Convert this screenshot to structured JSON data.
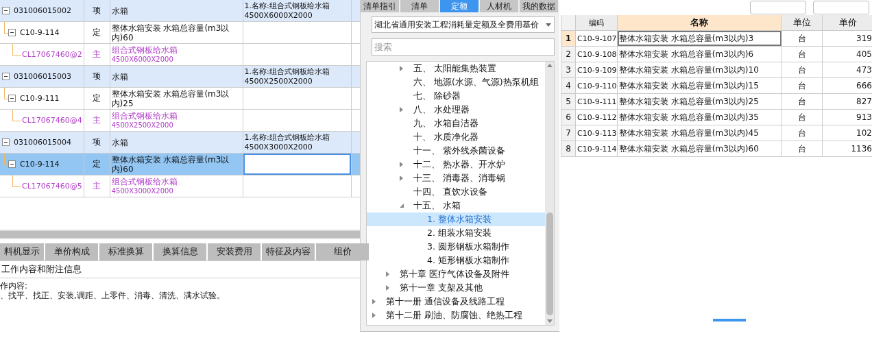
{
  "left_table": {
    "rows": [
      {
        "kind": "item",
        "code": "031006015002",
        "type": "项",
        "name": "水箱",
        "feature": [
          "1.名称:组合式钢板给水箱",
          "4500X6000X2000"
        ],
        "expanded": true,
        "selected": false
      },
      {
        "kind": "quota",
        "code": "C10-9-114",
        "type": "定",
        "name": "整体水箱安装  水箱总容量(m3以内)60",
        "expanded": true,
        "selected": false
      },
      {
        "kind": "material",
        "code": "CL17067460@2",
        "type": "主",
        "name": "组合式钢板给水箱",
        "spec": "4500X6000X2000",
        "selected": false
      },
      {
        "kind": "item",
        "code": "031006015003",
        "type": "项",
        "name": "水箱",
        "feature": [
          "1.名称:组合式钢板给水箱",
          "4500X2500X2000"
        ],
        "expanded": true,
        "selected": false
      },
      {
        "kind": "quota",
        "code": "C10-9-111",
        "type": "定",
        "name": "整体水箱安装  水箱总容量(m3以内)25",
        "expanded": true,
        "selected": false
      },
      {
        "kind": "material",
        "code": "CL17067460@4",
        "type": "主",
        "name": "组合式钢板给水箱",
        "spec": "4500X2500X2000",
        "selected": false
      },
      {
        "kind": "item",
        "code": "031006015004",
        "type": "项",
        "name": "水箱",
        "feature": [
          "1.名称:组合式钢板给水箱",
          "4500X3000X2000"
        ],
        "expanded": true,
        "selected": false
      },
      {
        "kind": "quota",
        "code": "C10-9-114",
        "type": "定",
        "name": "整体水箱安装  水箱总容量(m3以内)60",
        "expanded": true,
        "selected": true
      },
      {
        "kind": "material",
        "code": "CL17067460@5",
        "type": "主",
        "name": "组合式钢板给水箱",
        "spec": "4500X3000X2000",
        "selected": false
      }
    ]
  },
  "bottom_tabs": [
    {
      "label": "料机显示",
      "selected": false
    },
    {
      "label": "单价构成",
      "selected": false
    },
    {
      "label": "标准换算",
      "selected": false
    },
    {
      "label": "换算信息",
      "selected": false
    },
    {
      "label": "安装费用",
      "selected": false
    },
    {
      "label": "特征及内容",
      "selected": false
    },
    {
      "label": "组价",
      "selected": false
    }
  ],
  "info_panel": {
    "title": "工作内容和附注信息",
    "lines": [
      "作内容:",
      "、找平、找正、安装,调距、上零件、消毒、清洗、满水试验。"
    ]
  },
  "right_tabs": [
    {
      "label": "清单指引",
      "selected": false
    },
    {
      "label": "清单",
      "selected": false
    },
    {
      "label": "定额",
      "selected": true
    },
    {
      "label": "人材机",
      "selected": false
    },
    {
      "label": "我的数据",
      "selected": false
    }
  ],
  "quota_library": {
    "value": "湖北省通用安装工程消耗量定额及全费用基价"
  },
  "search": {
    "placeholder": "搜索"
  },
  "tree": [
    {
      "children": [
        {
          "children": [
            {
              "label": "五、 太阳能集热装置",
              "expanded": false,
              "selected": false
            },
            {
              "label": "六、 地源(水源、气源)热泵机组",
              "selected": false
            },
            {
              "label": "七、 除砂器",
              "selected": false
            },
            {
              "label": "八、 水处理器",
              "expanded": false,
              "selected": false
            },
            {
              "label": "九、 水箱自洁器",
              "selected": false
            },
            {
              "label": "十、 水质净化器",
              "selected": false
            },
            {
              "label": "十一、 紫外线杀菌设备",
              "selected": false
            },
            {
              "label": "十二、 热水器、开水炉",
              "expanded": false,
              "selected": false
            },
            {
              "label": "十三、 消毒器、消毒锅",
              "expanded": false,
              "selected": false
            },
            {
              "label": "十四、 直饮水设备",
              "selected": false
            },
            {
              "label": "十五、 水箱",
              "expanded": true,
              "selected": false,
              "children": [
                {
                  "label": "1. 整体水箱安装",
                  "selected": true
                },
                {
                  "label": "2. 组装水箱安装",
                  "selected": false
                },
                {
                  "label": "3. 圆形钢板水箱制作",
                  "selected": false
                },
                {
                  "label": "4. 矩形钢板水箱制作",
                  "selected": false
                }
              ]
            }
          ]
        },
        {
          "label": "第十章 医疗气体设备及附件",
          "expanded": false,
          "selected": false
        },
        {
          "label": "第十一章 支架及其他",
          "expanded": false,
          "selected": false
        }
      ]
    },
    {
      "label": "第十一册 通信设备及线路工程",
      "expanded": false,
      "selected": false
    },
    {
      "label": "第十二册 刷油、防腐蚀、绝热工程",
      "expanded": false,
      "selected": false
    }
  ],
  "quota_table": {
    "columns": [
      {
        "label": "编码",
        "selected": false
      },
      {
        "label": "名称",
        "selected": true
      },
      {
        "label": "单位",
        "selected": false
      },
      {
        "label": "单价",
        "selected": false
      }
    ],
    "rows": [
      {
        "num": "1",
        "code": "C10-9-107",
        "name": "整体水箱安装  水箱总容量(m3以内)3",
        "unit": "台",
        "price": "319",
        "selected": true
      },
      {
        "num": "2",
        "code": "C10-9-108",
        "name": "整体水箱安装  水箱总容量(m3以内)6",
        "unit": "台",
        "price": "405",
        "selected": false
      },
      {
        "num": "3",
        "code": "C10-9-109",
        "name": "整体水箱安装  水箱总容量(m3以内)10",
        "unit": "台",
        "price": "473",
        "selected": false
      },
      {
        "num": "4",
        "code": "C10-9-110",
        "name": "整体水箱安装  水箱总容量(m3以内)15",
        "unit": "台",
        "price": "666",
        "selected": false
      },
      {
        "num": "5",
        "code": "C10-9-111",
        "name": "整体水箱安装  水箱总容量(m3以内)25",
        "unit": "台",
        "price": "827",
        "selected": false
      },
      {
        "num": "6",
        "code": "C10-9-112",
        "name": "整体水箱安装  水箱总容量(m3以内)35",
        "unit": "台",
        "price": "913",
        "selected": false
      },
      {
        "num": "7",
        "code": "C10-9-113",
        "name": "整体水箱安装  水箱总容量(m3以内)45",
        "unit": "台",
        "price": "102",
        "selected": false
      },
      {
        "num": "8",
        "code": "C10-9-114",
        "name": "整体水箱安装  水箱总容量(m3以内)60",
        "unit": "台",
        "price": "1136",
        "selected": false
      }
    ]
  }
}
